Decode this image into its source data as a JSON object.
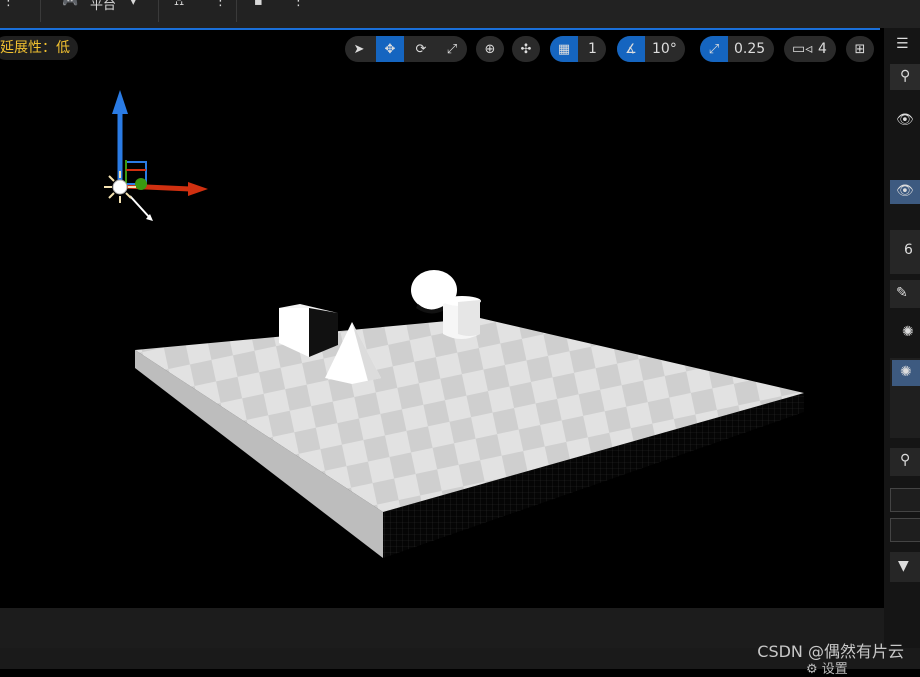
{
  "toolbar": {
    "platform_label": "平台",
    "more": "⋮"
  },
  "viewport": {
    "scalability_label": "延展性：低",
    "grid_snap_value": "1",
    "rotation_snap_value": "10°",
    "scale_snap_value": "0.25",
    "camera_speed_value": "4"
  },
  "right_panel": {
    "count_text": "6"
  },
  "footer": {
    "settings_label": "设置"
  },
  "watermark": "CSDN @偶然有片云",
  "colors": {
    "accent": "#1565c0",
    "scalability_text": "#f0c030",
    "gizmo_z": "#2a7be4",
    "gizmo_x": "#d03010",
    "gizmo_y": "#3a9a10"
  }
}
